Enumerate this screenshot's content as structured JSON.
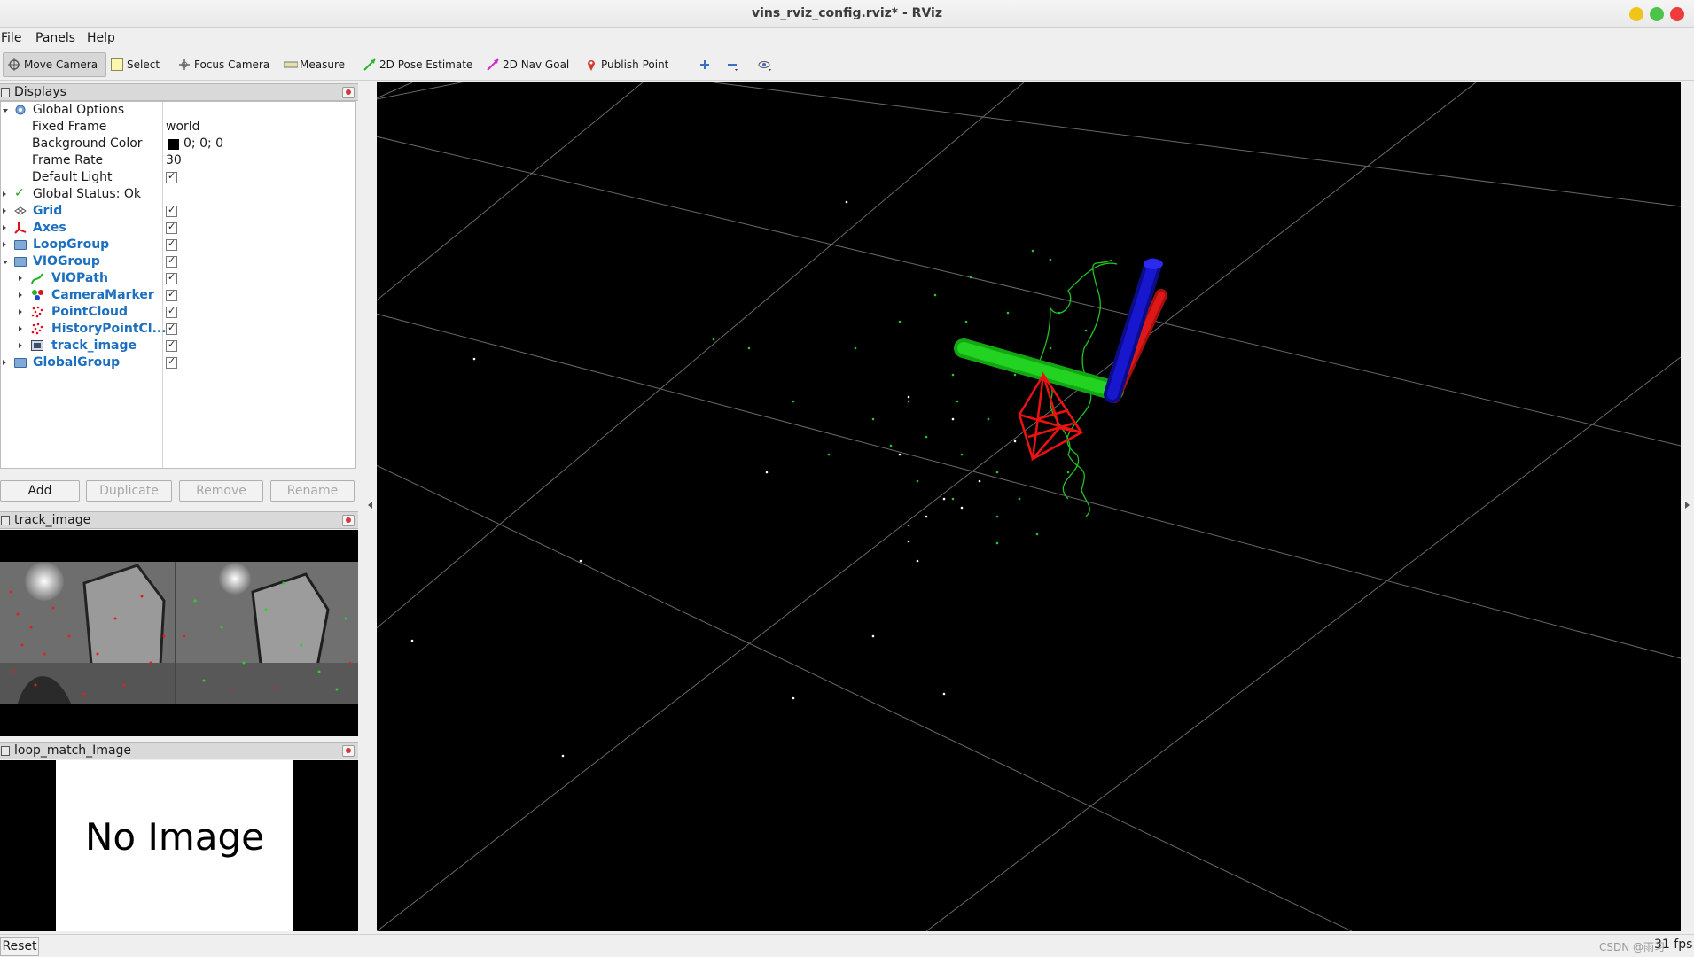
{
  "window": {
    "title": "vins_rviz_config.rviz* - RViz"
  },
  "menu": [
    "File",
    "Panels",
    "Help"
  ],
  "toolbar": {
    "move_camera": "Move Camera",
    "select": "Select",
    "focus_camera": "Focus Camera",
    "measure": "Measure",
    "pose_estimate": "2D Pose Estimate",
    "nav_goal": "2D Nav Goal",
    "publish_point": "Publish Point"
  },
  "displays": {
    "title": "Displays",
    "global_options": "Global Options",
    "fixed_frame_label": "Fixed Frame",
    "fixed_frame_value": "world",
    "background_color_label": "Background Color",
    "background_color_value": "0; 0; 0",
    "frame_rate_label": "Frame Rate",
    "frame_rate_value": "30",
    "default_light_label": "Default Light",
    "global_status": "Global Status: Ok",
    "items": [
      "Grid",
      "Axes",
      "LoopGroup",
      "VIOGroup",
      "VIOPath",
      "CameraMarker",
      "PointCloud",
      "HistoryPointCl...",
      "track_image",
      "GlobalGroup"
    ]
  },
  "buttons": {
    "add": "Add",
    "duplicate": "Duplicate",
    "remove": "Remove",
    "rename": "Rename"
  },
  "track_panel": {
    "title": "track_image"
  },
  "loop_panel": {
    "title": "loop_match_Image",
    "placeholder": "No Image"
  },
  "status": {
    "reset": "Reset",
    "fps": "31 fps",
    "watermark": "CSDN @雨习"
  },
  "colors": {
    "grid": "#a0a0a0",
    "path": "#22c322",
    "axis_x": "#d11",
    "axis_y": "#1c1",
    "axis_z": "#11c",
    "camera": "#ee1111"
  }
}
